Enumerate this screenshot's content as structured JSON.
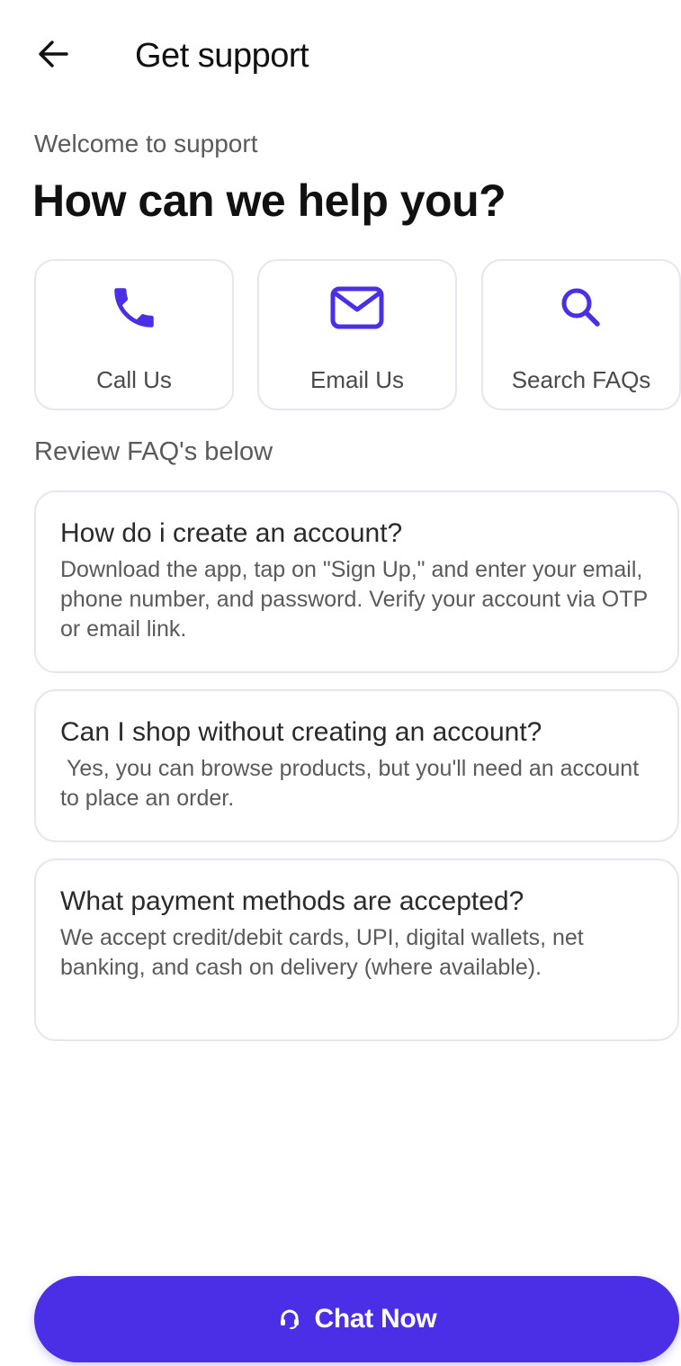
{
  "header": {
    "title": "Get support",
    "back_icon": "arrow-left-icon"
  },
  "intro": {
    "welcome": "Welcome to support",
    "headline": "How can we help you?"
  },
  "actions": [
    {
      "label": "Call Us",
      "icon": "phone-icon"
    },
    {
      "label": "Email Us",
      "icon": "envelope-icon"
    },
    {
      "label": "Search FAQs",
      "icon": "search-icon"
    }
  ],
  "faq": {
    "heading": "Review FAQ's below",
    "items": [
      {
        "question": "How do i create an account?",
        "answer": "Download the app, tap on \"Sign Up,\" and enter your email, phone number, and password. Verify your account via OTP or email link."
      },
      {
        "question": "Can I shop without creating an account?",
        "answer": " Yes, you can browse products, but you'll need an account to place an order."
      },
      {
        "question": "What payment methods are accepted?",
        "answer": "We accept credit/debit cards, UPI, digital wallets, net banking, and cash on delivery (where available)."
      }
    ]
  },
  "chat": {
    "label": "Chat Now",
    "icon": "headset-icon"
  },
  "colors": {
    "accent": "#4a2fe6",
    "card_border": "#e6e6ee",
    "text_primary": "#111111",
    "text_secondary": "#5a5a5a"
  }
}
